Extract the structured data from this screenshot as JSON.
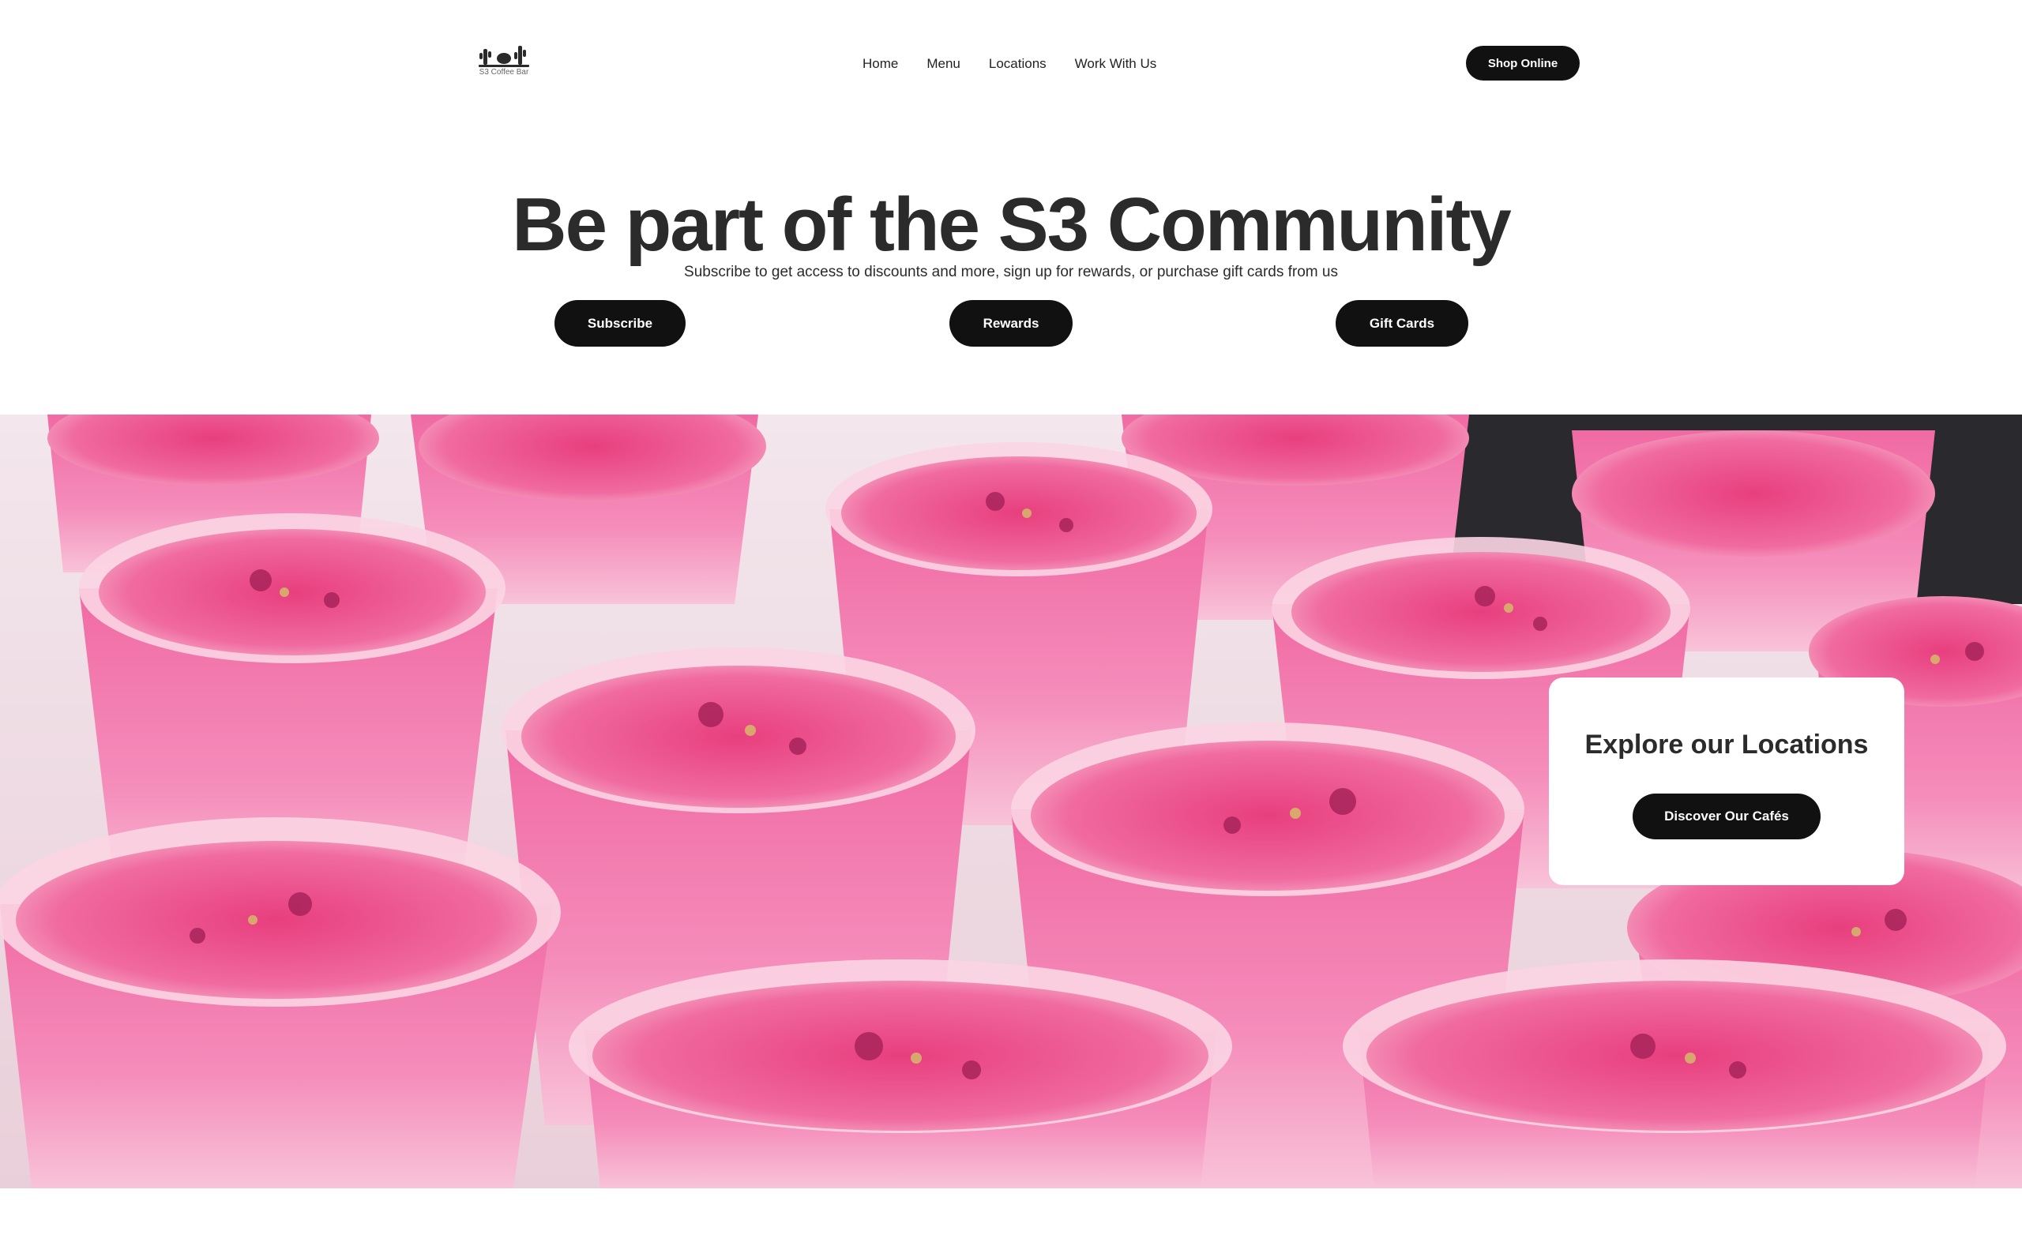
{
  "header": {
    "logo_text": "S3 Coffee Bar",
    "nav": [
      "Home",
      "Menu",
      "Locations",
      "Work With Us"
    ],
    "shop_label": "Shop Online"
  },
  "hero": {
    "title": "Be part of the S3 Community",
    "subtitle": "Subscribe to get access to discounts and more, sign up for rewards, or purchase gift cards from us",
    "buttons": {
      "subscribe": "Subscribe",
      "rewards": "Rewards",
      "gift_cards": "Gift Cards"
    }
  },
  "locations": {
    "title": "Explore our Locations",
    "button_label": "Discover Our Cafés"
  },
  "colors": {
    "button_bg": "#111111",
    "button_text": "#ffffff",
    "heading": "#2b2b2b",
    "photo_pink": "#ee6ea4"
  },
  "icons": {
    "logo": "cactus-logo-icon"
  }
}
